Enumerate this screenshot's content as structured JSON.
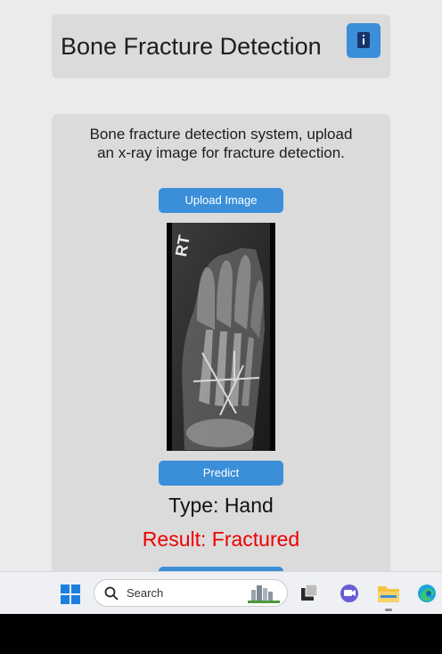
{
  "header": {
    "title": "Bone Fracture Detection",
    "info_icon": "info-icon"
  },
  "main": {
    "description": "Bone fracture detection system, upload an x-ray image for fracture detection.",
    "upload_label": "Upload Image",
    "xray_marker": "RT",
    "predict_label": "Predict",
    "type_text": "Type: Hand",
    "result_text": "Result: Fractured"
  },
  "taskbar": {
    "search_placeholder": "Search",
    "icons": [
      "windows-start-icon",
      "search-icon",
      "task-view-icon",
      "chat-icon",
      "file-explorer-icon",
      "edge-icon"
    ]
  },
  "colors": {
    "accent": "#3a8fd8",
    "result_red": "#ee0000",
    "panel": "#dbdbdb",
    "background": "#ebebeb"
  }
}
